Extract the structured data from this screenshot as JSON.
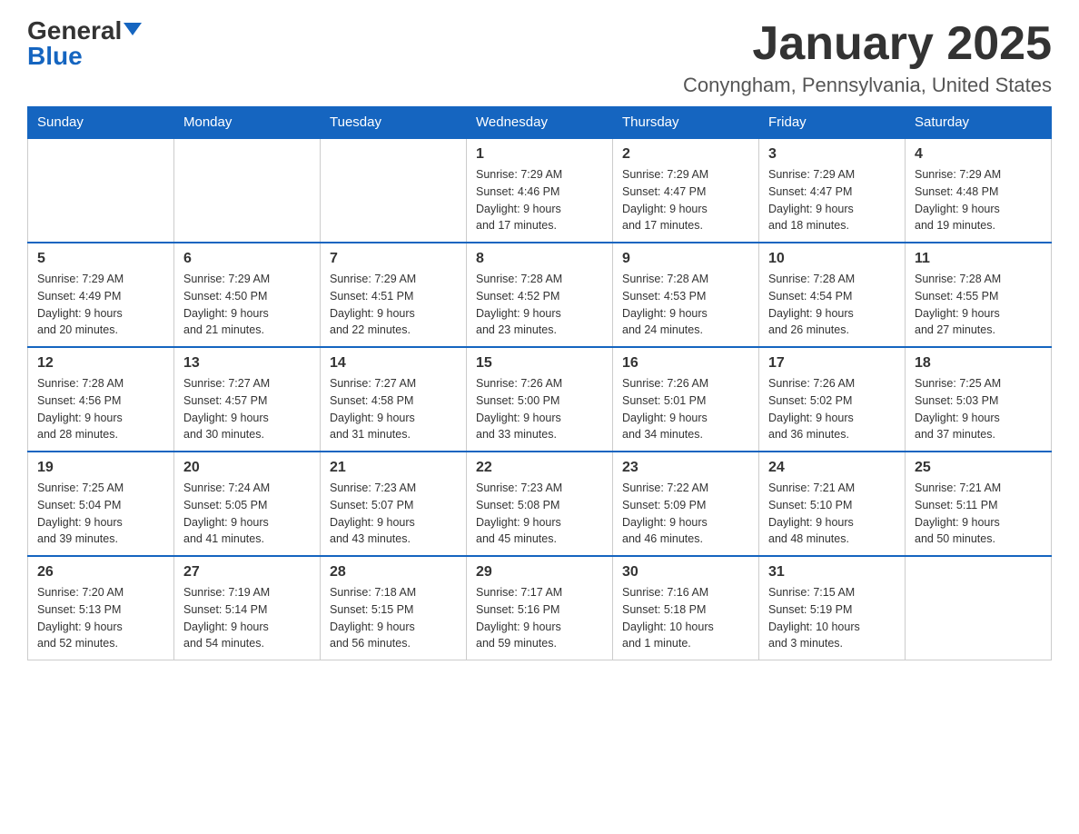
{
  "logo": {
    "general": "General",
    "blue": "Blue"
  },
  "title": {
    "month": "January 2025",
    "location": "Conyngham, Pennsylvania, United States"
  },
  "weekdays": [
    "Sunday",
    "Monday",
    "Tuesday",
    "Wednesday",
    "Thursday",
    "Friday",
    "Saturday"
  ],
  "weeks": [
    [
      {
        "day": "",
        "info": ""
      },
      {
        "day": "",
        "info": ""
      },
      {
        "day": "",
        "info": ""
      },
      {
        "day": "1",
        "info": "Sunrise: 7:29 AM\nSunset: 4:46 PM\nDaylight: 9 hours\nand 17 minutes."
      },
      {
        "day": "2",
        "info": "Sunrise: 7:29 AM\nSunset: 4:47 PM\nDaylight: 9 hours\nand 17 minutes."
      },
      {
        "day": "3",
        "info": "Sunrise: 7:29 AM\nSunset: 4:47 PM\nDaylight: 9 hours\nand 18 minutes."
      },
      {
        "day": "4",
        "info": "Sunrise: 7:29 AM\nSunset: 4:48 PM\nDaylight: 9 hours\nand 19 minutes."
      }
    ],
    [
      {
        "day": "5",
        "info": "Sunrise: 7:29 AM\nSunset: 4:49 PM\nDaylight: 9 hours\nand 20 minutes."
      },
      {
        "day": "6",
        "info": "Sunrise: 7:29 AM\nSunset: 4:50 PM\nDaylight: 9 hours\nand 21 minutes."
      },
      {
        "day": "7",
        "info": "Sunrise: 7:29 AM\nSunset: 4:51 PM\nDaylight: 9 hours\nand 22 minutes."
      },
      {
        "day": "8",
        "info": "Sunrise: 7:28 AM\nSunset: 4:52 PM\nDaylight: 9 hours\nand 23 minutes."
      },
      {
        "day": "9",
        "info": "Sunrise: 7:28 AM\nSunset: 4:53 PM\nDaylight: 9 hours\nand 24 minutes."
      },
      {
        "day": "10",
        "info": "Sunrise: 7:28 AM\nSunset: 4:54 PM\nDaylight: 9 hours\nand 26 minutes."
      },
      {
        "day": "11",
        "info": "Sunrise: 7:28 AM\nSunset: 4:55 PM\nDaylight: 9 hours\nand 27 minutes."
      }
    ],
    [
      {
        "day": "12",
        "info": "Sunrise: 7:28 AM\nSunset: 4:56 PM\nDaylight: 9 hours\nand 28 minutes."
      },
      {
        "day": "13",
        "info": "Sunrise: 7:27 AM\nSunset: 4:57 PM\nDaylight: 9 hours\nand 30 minutes."
      },
      {
        "day": "14",
        "info": "Sunrise: 7:27 AM\nSunset: 4:58 PM\nDaylight: 9 hours\nand 31 minutes."
      },
      {
        "day": "15",
        "info": "Sunrise: 7:26 AM\nSunset: 5:00 PM\nDaylight: 9 hours\nand 33 minutes."
      },
      {
        "day": "16",
        "info": "Sunrise: 7:26 AM\nSunset: 5:01 PM\nDaylight: 9 hours\nand 34 minutes."
      },
      {
        "day": "17",
        "info": "Sunrise: 7:26 AM\nSunset: 5:02 PM\nDaylight: 9 hours\nand 36 minutes."
      },
      {
        "day": "18",
        "info": "Sunrise: 7:25 AM\nSunset: 5:03 PM\nDaylight: 9 hours\nand 37 minutes."
      }
    ],
    [
      {
        "day": "19",
        "info": "Sunrise: 7:25 AM\nSunset: 5:04 PM\nDaylight: 9 hours\nand 39 minutes."
      },
      {
        "day": "20",
        "info": "Sunrise: 7:24 AM\nSunset: 5:05 PM\nDaylight: 9 hours\nand 41 minutes."
      },
      {
        "day": "21",
        "info": "Sunrise: 7:23 AM\nSunset: 5:07 PM\nDaylight: 9 hours\nand 43 minutes."
      },
      {
        "day": "22",
        "info": "Sunrise: 7:23 AM\nSunset: 5:08 PM\nDaylight: 9 hours\nand 45 minutes."
      },
      {
        "day": "23",
        "info": "Sunrise: 7:22 AM\nSunset: 5:09 PM\nDaylight: 9 hours\nand 46 minutes."
      },
      {
        "day": "24",
        "info": "Sunrise: 7:21 AM\nSunset: 5:10 PM\nDaylight: 9 hours\nand 48 minutes."
      },
      {
        "day": "25",
        "info": "Sunrise: 7:21 AM\nSunset: 5:11 PM\nDaylight: 9 hours\nand 50 minutes."
      }
    ],
    [
      {
        "day": "26",
        "info": "Sunrise: 7:20 AM\nSunset: 5:13 PM\nDaylight: 9 hours\nand 52 minutes."
      },
      {
        "day": "27",
        "info": "Sunrise: 7:19 AM\nSunset: 5:14 PM\nDaylight: 9 hours\nand 54 minutes."
      },
      {
        "day": "28",
        "info": "Sunrise: 7:18 AM\nSunset: 5:15 PM\nDaylight: 9 hours\nand 56 minutes."
      },
      {
        "day": "29",
        "info": "Sunrise: 7:17 AM\nSunset: 5:16 PM\nDaylight: 9 hours\nand 59 minutes."
      },
      {
        "day": "30",
        "info": "Sunrise: 7:16 AM\nSunset: 5:18 PM\nDaylight: 10 hours\nand 1 minute."
      },
      {
        "day": "31",
        "info": "Sunrise: 7:15 AM\nSunset: 5:19 PM\nDaylight: 10 hours\nand 3 minutes."
      },
      {
        "day": "",
        "info": ""
      }
    ]
  ]
}
